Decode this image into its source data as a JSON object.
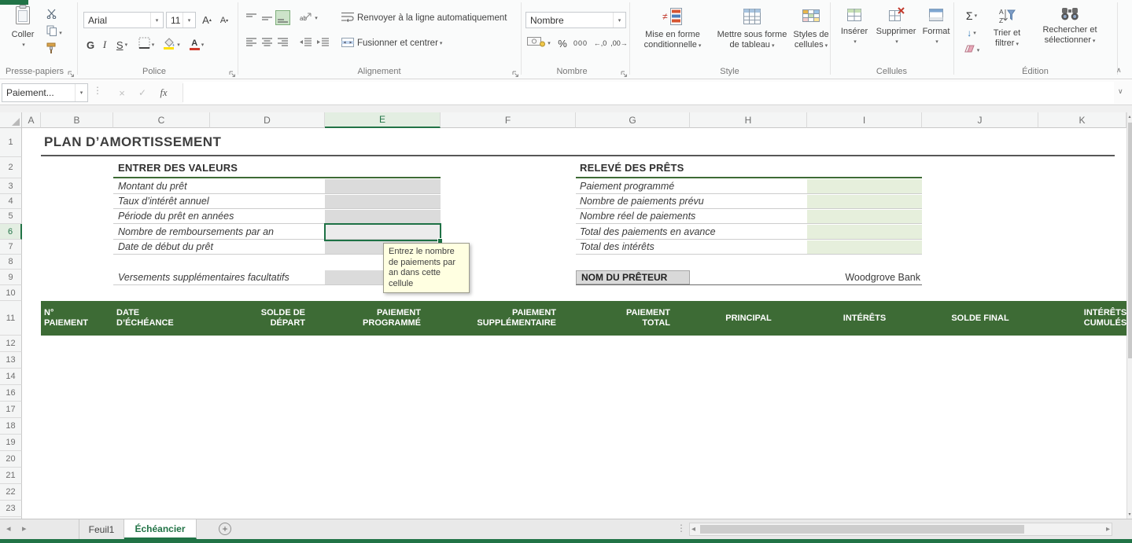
{
  "ribbon": {
    "clipboard": {
      "group_label": "Presse-papiers",
      "paste_label": "Coller"
    },
    "font": {
      "group_label": "Police",
      "font_name": "Arial",
      "font_size": "11",
      "bold_label": "G",
      "italic_label": "I",
      "underline_label": "S"
    },
    "alignment": {
      "group_label": "Alignement",
      "wrap_label": "Renvoyer à la ligne automatiquement",
      "merge_label": "Fusionner et centrer"
    },
    "number": {
      "group_label": "Nombre",
      "format_value": "Nombre",
      "percent_label": "%",
      "thousands_label": "000",
      "increase_decimal_label": "←,0",
      "decrease_decimal_label": ",00→"
    },
    "style": {
      "group_label": "Style",
      "conditional_line1": "Mise en forme",
      "conditional_line2": "conditionnelle",
      "table_line1": "Mettre sous forme",
      "table_line2": "de tableau",
      "cellstyles_line1": "Styles de",
      "cellstyles_line2": "cellules"
    },
    "cells": {
      "group_label": "Cellules",
      "insert_label": "Insérer",
      "delete_label": "Supprimer",
      "format_label": "Format"
    },
    "editing": {
      "group_label": "Édition",
      "autosum_label": "Σ",
      "sort_line1": "Trier et",
      "sort_line2": "filtrer",
      "find_line1": "Rechercher et",
      "find_line2": "sélectionner"
    }
  },
  "formula_bar": {
    "name_box_value": "Paiement...",
    "fx_label": "fx",
    "formula_value": ""
  },
  "grid": {
    "column_headers": [
      "A",
      "B",
      "C",
      "D",
      "E",
      "F",
      "G",
      "H",
      "I",
      "J",
      "K"
    ],
    "row_headers": [
      "1",
      "2",
      "3",
      "4",
      "5",
      "6",
      "7",
      "8",
      "9",
      "10",
      "11",
      "12",
      "13",
      "14",
      "16",
      "17",
      "18",
      "19",
      "20",
      "21",
      "22",
      "23"
    ],
    "selected_column": "E",
    "selected_row": "6"
  },
  "sheet": {
    "title": "PLAN D’AMORTISSEMENT",
    "enter_values": {
      "header": "ENTRER DES VALEURS",
      "labels": [
        "Montant du prêt",
        "Taux d’intérêt annuel",
        "Période du prêt en années",
        "Nombre de remboursements par an",
        "Date de début du prêt"
      ],
      "optional_label": "Versements supplémentaires facultatifs"
    },
    "loan_summary": {
      "header": "RELEVÉ DES PRÊTS",
      "labels": [
        "Paiement programmé",
        "Nombre de paiements prévu",
        "Nombre réel de paiements",
        "Total des paiements en avance",
        "Total des intérêts"
      ]
    },
    "lender": {
      "label": "NOM DU PRÊTEUR",
      "value": "Woodgrove Bank"
    },
    "tooltip_text": "Entrez le nombre de paiements par an dans cette cellule",
    "table_headers": [
      "N°\nPAIEMENT",
      "DATE\nD’ÉCHÉANCE",
      "SOLDE DE\nDÉPART",
      "PAIEMENT\nPROGRAMMÉ",
      "PAIEMENT\nSUPPLÉMENTAIRE",
      "PAIEMENT\nTOTAL",
      "PRINCIPAL",
      "INTÉRÊTS",
      "SOLDE FINAL",
      "INTÉRÊTS\nCUMULÉS"
    ]
  },
  "tabs": {
    "sheet1_label": "Feuil1",
    "active_label": "Échéancier",
    "add_label": "+"
  },
  "colors": {
    "accent": "#217346",
    "table_header_bg": "#3D6B35",
    "input_fill": "#DBDBDB",
    "summary_fill": "#E6EFDC",
    "tooltip_bg": "#FFFFE1"
  }
}
